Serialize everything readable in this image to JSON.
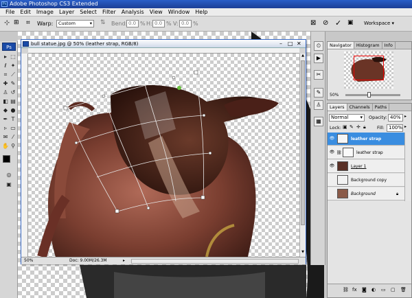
{
  "app": {
    "title": "Adobe Photoshop CS3 Extended",
    "logo": "Ps"
  },
  "menu": [
    "File",
    "Edit",
    "Image",
    "Layer",
    "Select",
    "Filter",
    "Analysis",
    "View",
    "Window",
    "Help"
  ],
  "options": {
    "warp_label": "Warp:",
    "warp_value": "Custom",
    "bend_label": "Bend:",
    "bend_value": "0.0",
    "bend_unit": "%",
    "h_label": "H:",
    "h_value": "0.0",
    "h_unit": "%",
    "v_label": "V:",
    "v_value": "0.0",
    "v_unit": "%",
    "workspace_label": "Workspace ▾"
  },
  "document": {
    "title": "bull statue.jpg @ 50% (leather strap, RGB/8)",
    "zoom": "50%",
    "doc_info": "Doc: 9.00M/26.3M"
  },
  "navigator": {
    "tabs": [
      "Navigator",
      "Histogram",
      "Info"
    ],
    "zoom": "50%"
  },
  "layers": {
    "tabs": [
      "Layers",
      "Channels",
      "Paths"
    ],
    "blend_mode": "Normal",
    "opacity_label": "Opacity:",
    "opacity_value": "40%",
    "lock_label": "Lock:",
    "fill_label": "Fill:",
    "fill_value": "100%",
    "items": [
      {
        "name": "leather strap",
        "selected": true
      },
      {
        "name": "leather strap",
        "selected": false
      },
      {
        "name": "Layer 1",
        "selected": false
      },
      {
        "name": "Background copy",
        "selected": false
      },
      {
        "name": "Background",
        "selected": false
      }
    ]
  },
  "colors": {
    "accent": "#3a8de0",
    "title": "#1c3f96"
  }
}
